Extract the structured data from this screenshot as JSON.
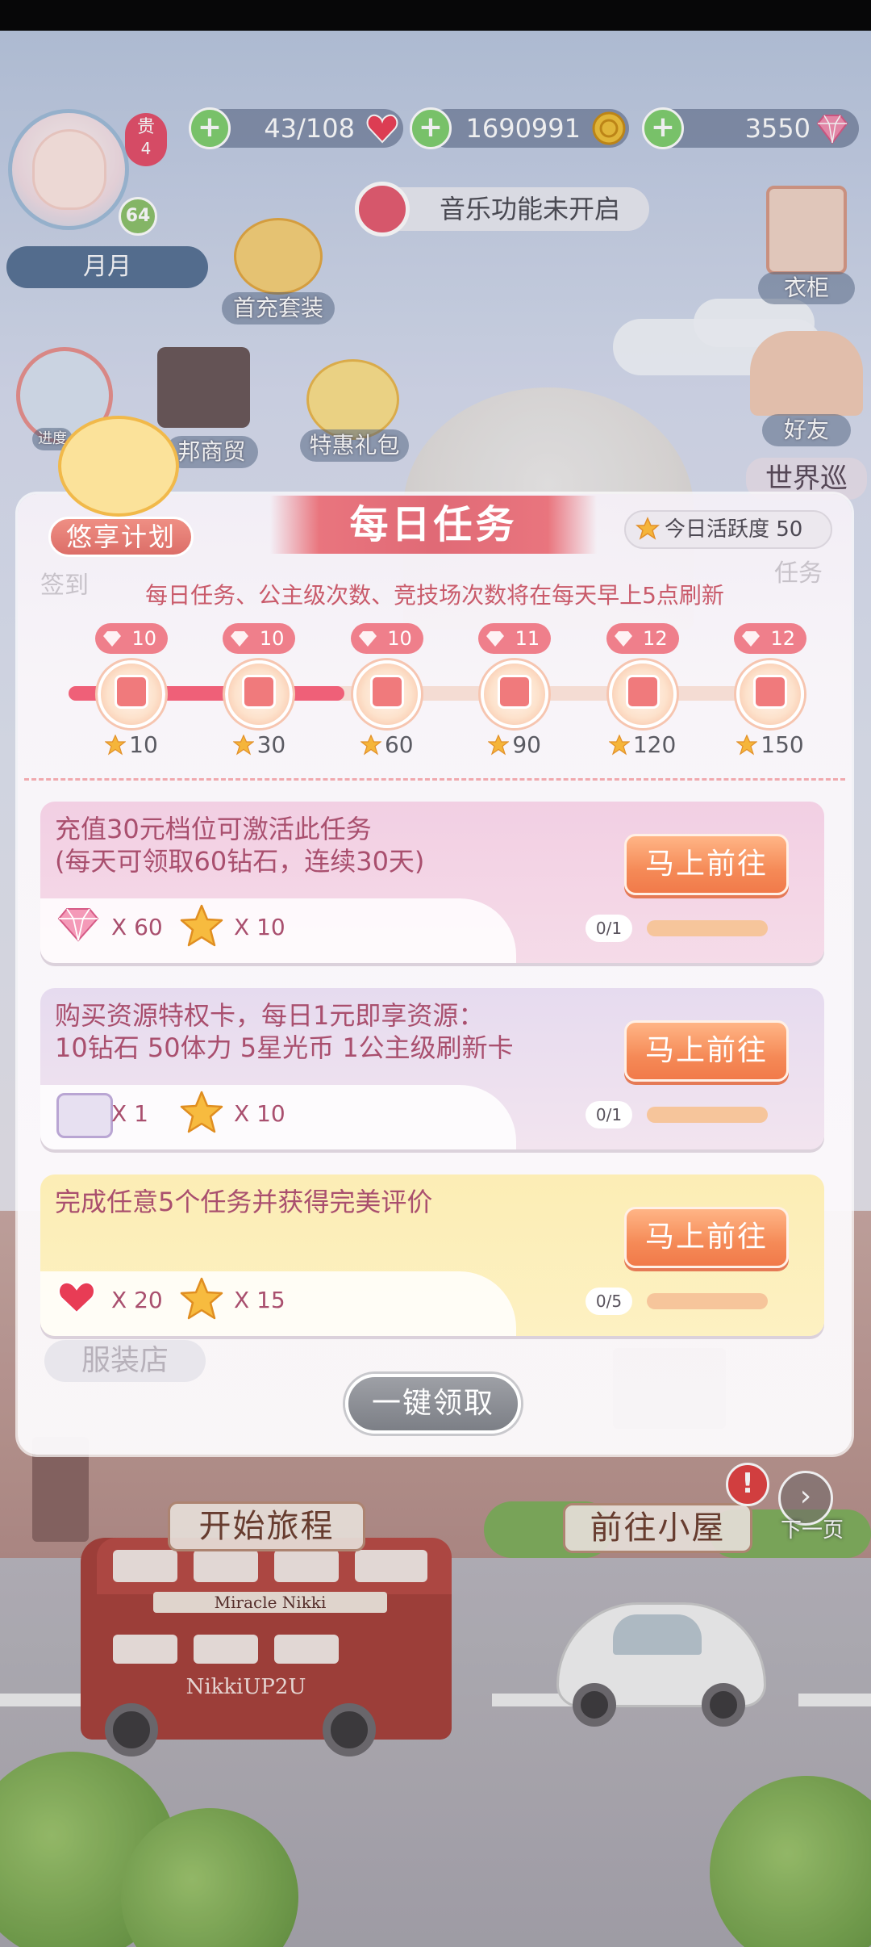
{
  "hud": {
    "vip_label": "贵",
    "vip_level": "4",
    "player_level": "64",
    "player_name": "月月",
    "stamina": "43/108",
    "gold": "1690991",
    "diamonds": "3550",
    "music_status": "音乐功能未开启",
    "first_charge_label": "首充套装",
    "wardrobe_label": "衣柜",
    "friends_label": "好友",
    "world_label": "世界巡",
    "shop_label": "邦商贸",
    "gift_pack_label": "特惠礼包",
    "progress_label": "进度",
    "task_label_bg": "任务",
    "checkin_label_bg": "签到"
  },
  "modal": {
    "title": "每日任务",
    "plan_badge": "悠享计划",
    "activity": "今日活跃度 50",
    "activity_value": 50,
    "notice": "每日任务、公主级次数、竞技场次数将在每天早上5点刷新",
    "milestones": [
      {
        "reward": "10",
        "threshold": "10"
      },
      {
        "reward": "10",
        "threshold": "30"
      },
      {
        "reward": "10",
        "threshold": "60"
      },
      {
        "reward": "11",
        "threshold": "90"
      },
      {
        "reward": "12",
        "threshold": "120"
      },
      {
        "reward": "12",
        "threshold": "150"
      }
    ],
    "tasks": [
      {
        "line1": "充值30元档位可激活此任务",
        "line2": "(每天可领取60钻石，连续30天)",
        "reward1_icon": "diamond-icon",
        "reward1": "X 60",
        "reward2_icon": "star-icon",
        "reward2": "X 10",
        "progress": "0/1",
        "progress_fraction": 0,
        "button": "马上前往"
      },
      {
        "line1": "购买资源特权卡，每日1元即享资源：",
        "line2": "10钻石 50体力 5星光币 1公主级刷新卡",
        "reward1_icon": "gift-box-icon",
        "reward1": "X 1",
        "reward2_icon": "star-icon",
        "reward2": "X 10",
        "progress": "0/1",
        "progress_fraction": 0,
        "button": "马上前往"
      },
      {
        "line1": "完成任意5个任务并获得完美评价",
        "line2": "",
        "reward1_icon": "heart-icon",
        "reward1": "X 20",
        "reward2_icon": "star-icon",
        "reward2": "X 15",
        "progress": "0/5",
        "progress_fraction": 0,
        "button": "马上前往"
      }
    ],
    "claim_all": "一键领取"
  },
  "bottom": {
    "start_journey": "开始旅程",
    "go_house": "前往小屋",
    "next_page": "下一页",
    "clothing_store": "服装店",
    "bus_sign": "Miracle Nikki",
    "bus_logo": "NikkiUP2U"
  },
  "colors": {
    "accent_pink": "#e9757e",
    "button_orange": "#f58a57",
    "progress_fill": "#ef6078",
    "card_text": "#a94f6e"
  }
}
